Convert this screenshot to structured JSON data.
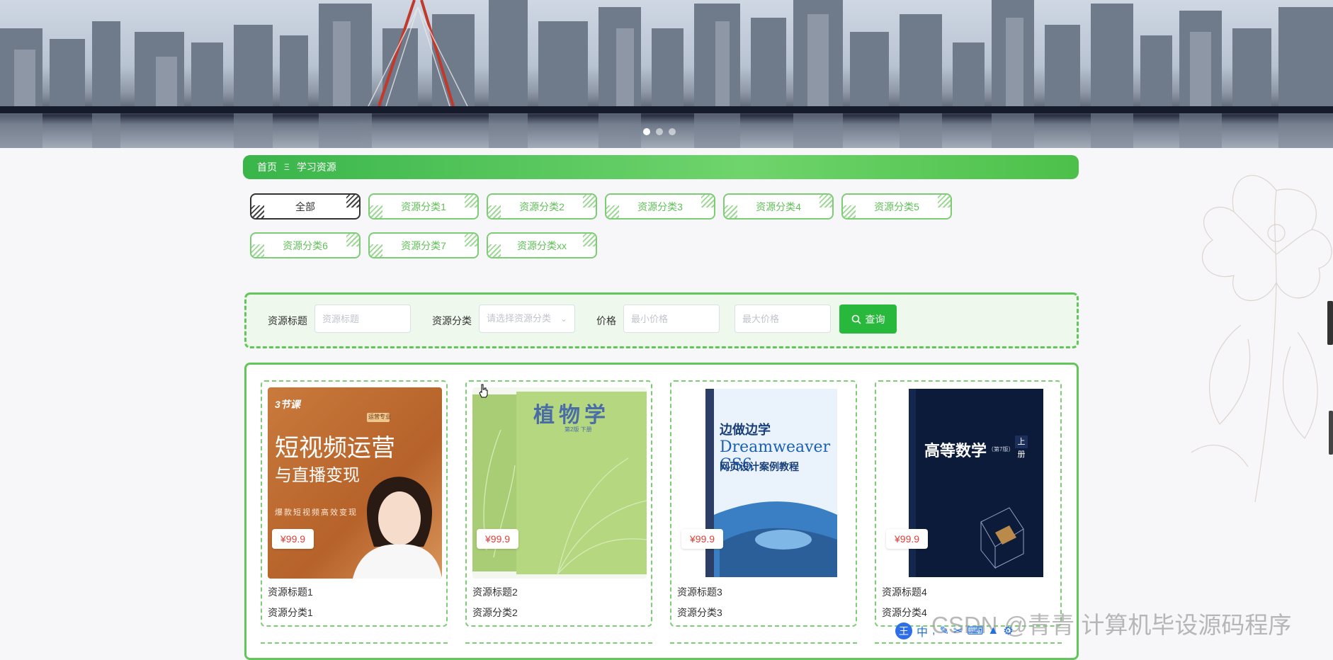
{
  "banner": {
    "slides": 3,
    "active_slide": 1
  },
  "breadcrumb": {
    "home": "首页",
    "separator": "Ξ",
    "current": "学习资源"
  },
  "categories": [
    {
      "label": "全部",
      "active": true
    },
    {
      "label": "资源分类1",
      "active": false
    },
    {
      "label": "资源分类2",
      "active": false
    },
    {
      "label": "资源分类3",
      "active": false
    },
    {
      "label": "资源分类4",
      "active": false
    },
    {
      "label": "资源分类5",
      "active": false
    },
    {
      "label": "资源分类6",
      "active": false
    },
    {
      "label": "资源分类7",
      "active": false
    },
    {
      "label": "资源分类xx",
      "active": false
    }
  ],
  "search": {
    "title_label": "资源标题",
    "title_placeholder": "资源标题",
    "category_label": "资源分类",
    "category_placeholder": "请选择资源分类",
    "price_label": "价格",
    "min_price_placeholder": "最小价格",
    "max_price_placeholder": "最大价格",
    "query_button": "查询"
  },
  "resources": [
    {
      "title": "资源标题1",
      "category": "资源分类1",
      "price": "¥99.9",
      "cover": {
        "brand": "3节课",
        "headline": "短视频运营",
        "sub": "与直播变现",
        "tagline": "爆款短视频高效变现",
        "tag": "运营专业"
      }
    },
    {
      "title": "资源标题2",
      "category": "资源分类2",
      "price": "¥99.9",
      "cover": {
        "headline": "植物学",
        "sub": "第2版 下册"
      }
    },
    {
      "title": "资源标题3",
      "category": "资源分类3",
      "price": "¥99.9",
      "cover": {
        "headline": "边做边学",
        "sub": "Dreamweaver CS6",
        "tagline": "网页设计案例教程"
      }
    },
    {
      "title": "资源标题4",
      "category": "资源分类4",
      "price": "¥99.9",
      "cover": {
        "headline": "高等数学",
        "sub": "（第7版）",
        "tag": "上册"
      }
    }
  ],
  "colors": {
    "accent": "#3cb64a",
    "tag_text": "#5fbf57",
    "price": "#e0403a"
  },
  "overlay": {
    "watermark": "CSDN @青青  计算机毕设源码程序",
    "ime_label": "中"
  }
}
